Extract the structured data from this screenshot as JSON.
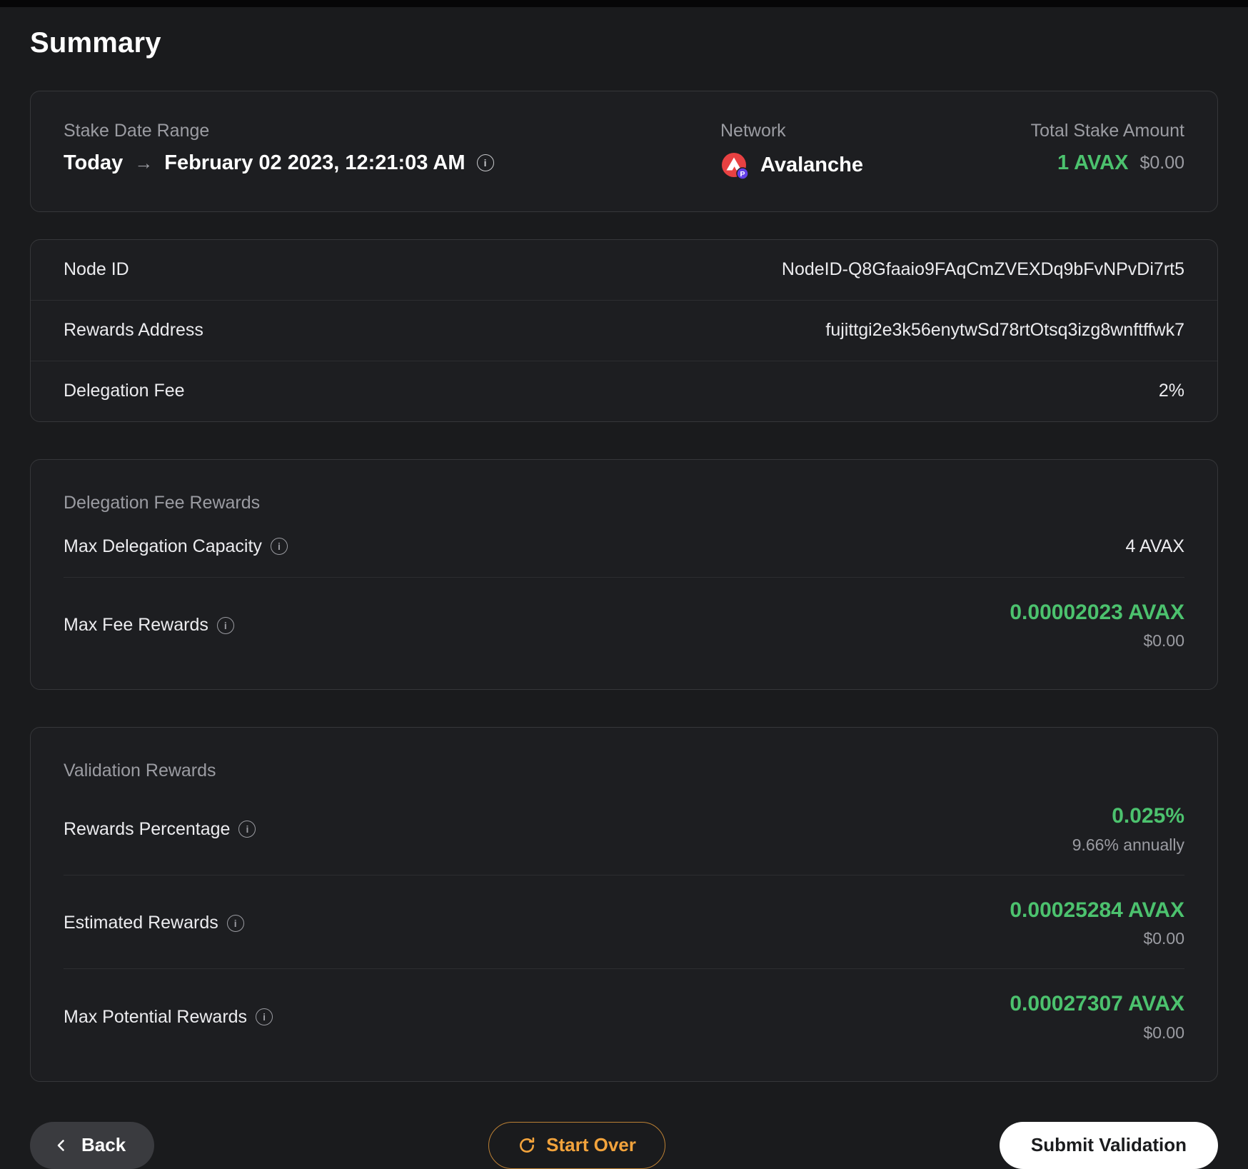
{
  "page": {
    "title": "Summary"
  },
  "summary_card": {
    "stake_date_range": {
      "label": "Stake Date Range",
      "from": "Today",
      "arrow": "→",
      "to": "February 02 2023, 12:21:03 AM"
    },
    "network": {
      "label": "Network",
      "name": "Avalanche"
    },
    "total_stake": {
      "label": "Total Stake Amount",
      "amount": "1 AVAX",
      "fiat": "$0.00"
    }
  },
  "details_table": {
    "rows": [
      {
        "label": "Node ID",
        "value": "NodeID-Q8Gfaaio9FAqCmZVEXDq9bFvNPvDi7rt5"
      },
      {
        "label": "Rewards Address",
        "value": "fujittgi2e3k56enytwSd78rtOtsq3izg8wnftffwk7"
      },
      {
        "label": "Delegation Fee",
        "value": "2%"
      }
    ]
  },
  "delegation_fee_rewards": {
    "title": "Delegation Fee Rewards",
    "max_delegation_capacity": {
      "label": "Max Delegation Capacity",
      "value": "4 AVAX"
    },
    "max_fee_rewards": {
      "label": "Max Fee Rewards",
      "value": "0.00002023 AVAX",
      "fiat": "$0.00"
    }
  },
  "validation_rewards": {
    "title": "Validation Rewards",
    "rewards_percentage": {
      "label": "Rewards Percentage",
      "value": "0.025%",
      "sub": "9.66% annually"
    },
    "estimated_rewards": {
      "label": "Estimated Rewards",
      "value": "0.00025284 AVAX",
      "fiat": "$0.00"
    },
    "max_potential_rewards": {
      "label": "Max Potential Rewards",
      "value": "0.00027307 AVAX",
      "fiat": "$0.00"
    }
  },
  "footer": {
    "back_label": "Back",
    "start_over_label": "Start Over",
    "submit_label": "Submit Validation"
  },
  "colors": {
    "accent-green": "#4CC26E",
    "accent-orange": "#F2A33C",
    "avalanche-red": "#E84142",
    "pchain-purple": "#6340E8"
  }
}
